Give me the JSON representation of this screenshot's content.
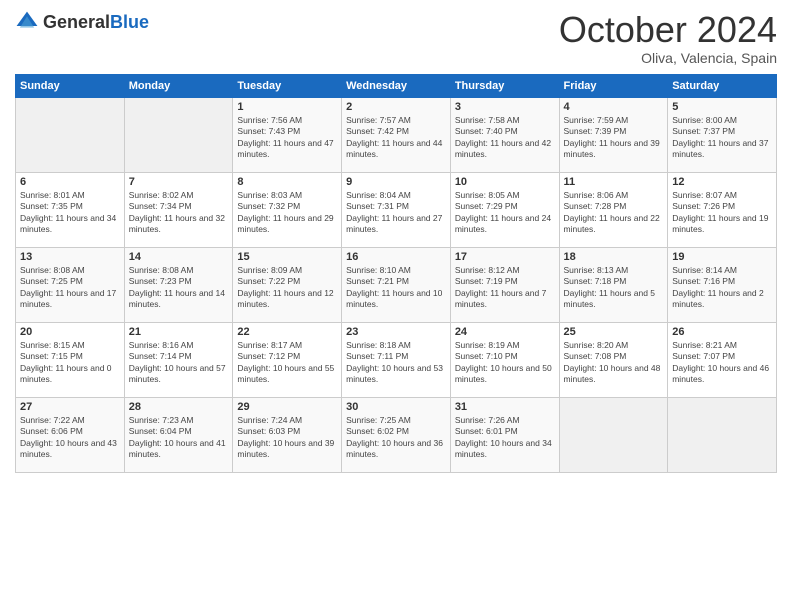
{
  "logo": {
    "general": "General",
    "blue": "Blue"
  },
  "header": {
    "month": "October 2024",
    "location": "Oliva, Valencia, Spain"
  },
  "weekdays": [
    "Sunday",
    "Monday",
    "Tuesday",
    "Wednesday",
    "Thursday",
    "Friday",
    "Saturday"
  ],
  "weeks": [
    [
      {
        "day": "",
        "empty": true
      },
      {
        "day": "",
        "empty": true
      },
      {
        "day": "1",
        "sunrise": "Sunrise: 7:56 AM",
        "sunset": "Sunset: 7:43 PM",
        "daylight": "Daylight: 11 hours and 47 minutes."
      },
      {
        "day": "2",
        "sunrise": "Sunrise: 7:57 AM",
        "sunset": "Sunset: 7:42 PM",
        "daylight": "Daylight: 11 hours and 44 minutes."
      },
      {
        "day": "3",
        "sunrise": "Sunrise: 7:58 AM",
        "sunset": "Sunset: 7:40 PM",
        "daylight": "Daylight: 11 hours and 42 minutes."
      },
      {
        "day": "4",
        "sunrise": "Sunrise: 7:59 AM",
        "sunset": "Sunset: 7:39 PM",
        "daylight": "Daylight: 11 hours and 39 minutes."
      },
      {
        "day": "5",
        "sunrise": "Sunrise: 8:00 AM",
        "sunset": "Sunset: 7:37 PM",
        "daylight": "Daylight: 11 hours and 37 minutes."
      }
    ],
    [
      {
        "day": "6",
        "sunrise": "Sunrise: 8:01 AM",
        "sunset": "Sunset: 7:35 PM",
        "daylight": "Daylight: 11 hours and 34 minutes."
      },
      {
        "day": "7",
        "sunrise": "Sunrise: 8:02 AM",
        "sunset": "Sunset: 7:34 PM",
        "daylight": "Daylight: 11 hours and 32 minutes."
      },
      {
        "day": "8",
        "sunrise": "Sunrise: 8:03 AM",
        "sunset": "Sunset: 7:32 PM",
        "daylight": "Daylight: 11 hours and 29 minutes."
      },
      {
        "day": "9",
        "sunrise": "Sunrise: 8:04 AM",
        "sunset": "Sunset: 7:31 PM",
        "daylight": "Daylight: 11 hours and 27 minutes."
      },
      {
        "day": "10",
        "sunrise": "Sunrise: 8:05 AM",
        "sunset": "Sunset: 7:29 PM",
        "daylight": "Daylight: 11 hours and 24 minutes."
      },
      {
        "day": "11",
        "sunrise": "Sunrise: 8:06 AM",
        "sunset": "Sunset: 7:28 PM",
        "daylight": "Daylight: 11 hours and 22 minutes."
      },
      {
        "day": "12",
        "sunrise": "Sunrise: 8:07 AM",
        "sunset": "Sunset: 7:26 PM",
        "daylight": "Daylight: 11 hours and 19 minutes."
      }
    ],
    [
      {
        "day": "13",
        "sunrise": "Sunrise: 8:08 AM",
        "sunset": "Sunset: 7:25 PM",
        "daylight": "Daylight: 11 hours and 17 minutes."
      },
      {
        "day": "14",
        "sunrise": "Sunrise: 8:08 AM",
        "sunset": "Sunset: 7:23 PM",
        "daylight": "Daylight: 11 hours and 14 minutes."
      },
      {
        "day": "15",
        "sunrise": "Sunrise: 8:09 AM",
        "sunset": "Sunset: 7:22 PM",
        "daylight": "Daylight: 11 hours and 12 minutes."
      },
      {
        "day": "16",
        "sunrise": "Sunrise: 8:10 AM",
        "sunset": "Sunset: 7:21 PM",
        "daylight": "Daylight: 11 hours and 10 minutes."
      },
      {
        "day": "17",
        "sunrise": "Sunrise: 8:12 AM",
        "sunset": "Sunset: 7:19 PM",
        "daylight": "Daylight: 11 hours and 7 minutes."
      },
      {
        "day": "18",
        "sunrise": "Sunrise: 8:13 AM",
        "sunset": "Sunset: 7:18 PM",
        "daylight": "Daylight: 11 hours and 5 minutes."
      },
      {
        "day": "19",
        "sunrise": "Sunrise: 8:14 AM",
        "sunset": "Sunset: 7:16 PM",
        "daylight": "Daylight: 11 hours and 2 minutes."
      }
    ],
    [
      {
        "day": "20",
        "sunrise": "Sunrise: 8:15 AM",
        "sunset": "Sunset: 7:15 PM",
        "daylight": "Daylight: 11 hours and 0 minutes."
      },
      {
        "day": "21",
        "sunrise": "Sunrise: 8:16 AM",
        "sunset": "Sunset: 7:14 PM",
        "daylight": "Daylight: 10 hours and 57 minutes."
      },
      {
        "day": "22",
        "sunrise": "Sunrise: 8:17 AM",
        "sunset": "Sunset: 7:12 PM",
        "daylight": "Daylight: 10 hours and 55 minutes."
      },
      {
        "day": "23",
        "sunrise": "Sunrise: 8:18 AM",
        "sunset": "Sunset: 7:11 PM",
        "daylight": "Daylight: 10 hours and 53 minutes."
      },
      {
        "day": "24",
        "sunrise": "Sunrise: 8:19 AM",
        "sunset": "Sunset: 7:10 PM",
        "daylight": "Daylight: 10 hours and 50 minutes."
      },
      {
        "day": "25",
        "sunrise": "Sunrise: 8:20 AM",
        "sunset": "Sunset: 7:08 PM",
        "daylight": "Daylight: 10 hours and 48 minutes."
      },
      {
        "day": "26",
        "sunrise": "Sunrise: 8:21 AM",
        "sunset": "Sunset: 7:07 PM",
        "daylight": "Daylight: 10 hours and 46 minutes."
      }
    ],
    [
      {
        "day": "27",
        "sunrise": "Sunrise: 7:22 AM",
        "sunset": "Sunset: 6:06 PM",
        "daylight": "Daylight: 10 hours and 43 minutes."
      },
      {
        "day": "28",
        "sunrise": "Sunrise: 7:23 AM",
        "sunset": "Sunset: 6:04 PM",
        "daylight": "Daylight: 10 hours and 41 minutes."
      },
      {
        "day": "29",
        "sunrise": "Sunrise: 7:24 AM",
        "sunset": "Sunset: 6:03 PM",
        "daylight": "Daylight: 10 hours and 39 minutes."
      },
      {
        "day": "30",
        "sunrise": "Sunrise: 7:25 AM",
        "sunset": "Sunset: 6:02 PM",
        "daylight": "Daylight: 10 hours and 36 minutes."
      },
      {
        "day": "31",
        "sunrise": "Sunrise: 7:26 AM",
        "sunset": "Sunset: 6:01 PM",
        "daylight": "Daylight: 10 hours and 34 minutes."
      },
      {
        "day": "",
        "empty": true
      },
      {
        "day": "",
        "empty": true
      }
    ]
  ]
}
